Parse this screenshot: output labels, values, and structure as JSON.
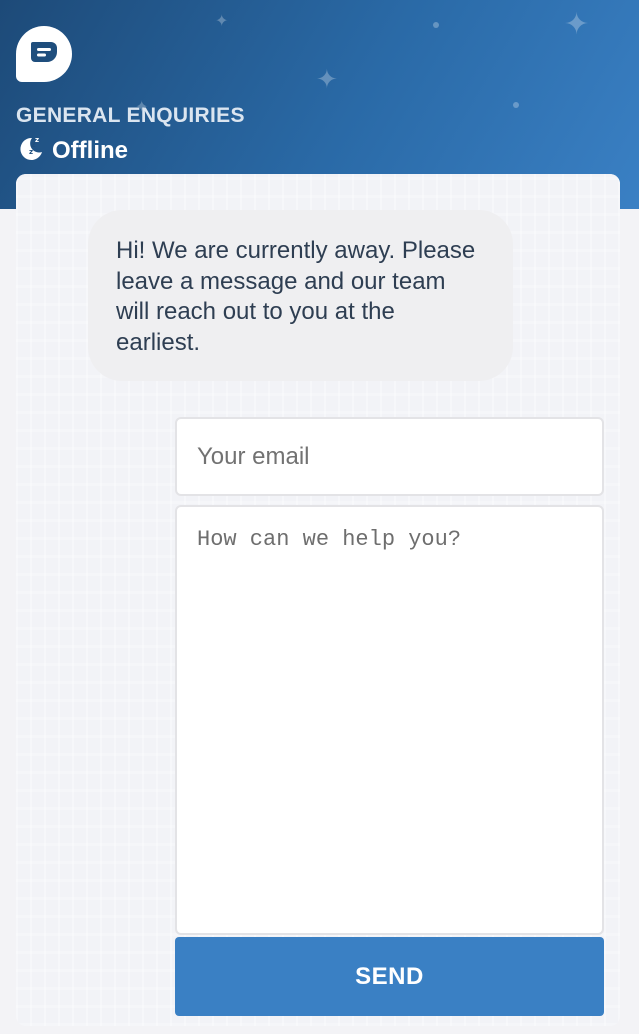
{
  "header": {
    "logo_icon": "chat-bubble-icon",
    "team_name": "GENERAL ENQUIRIES",
    "status_icon": "moon-sleep-icon",
    "status": "Offline",
    "gradient_colors": [
      "#1d4a78",
      "#3a80c4"
    ]
  },
  "chat": {
    "away_message": "Hi! We are currently away. Please leave a message and our team will reach out to you at the earliest."
  },
  "form": {
    "email_placeholder": "Your email",
    "email_value": "",
    "message_placeholder": "How can we help you?",
    "message_value": "",
    "send_label": "SEND"
  },
  "colors": {
    "accent": "#3a80c4",
    "bubble_bg": "#efeff1",
    "text": "#2e3e52"
  }
}
